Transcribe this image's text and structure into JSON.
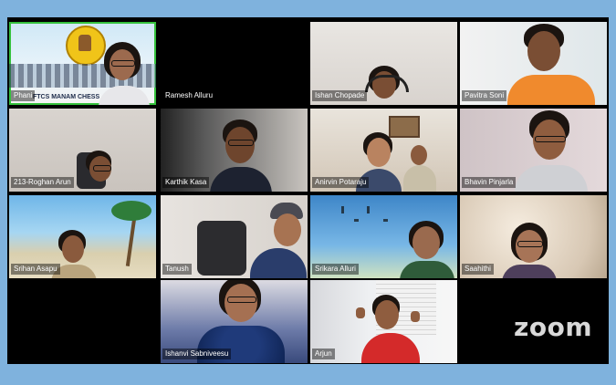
{
  "meeting": {
    "app": "zoom",
    "participants": [
      {
        "name": "Phani",
        "banner": "FTCS MANAM CHESS",
        "active": true
      },
      {
        "name": "Ramesh Alluru"
      },
      {
        "name": "Ishan Chopade"
      },
      {
        "name": "Pavitra Soni"
      },
      {
        "name": "213-Roghan Arun"
      },
      {
        "name": "Karthik Kasa"
      },
      {
        "name": "Anirvin Potaraju"
      },
      {
        "name": "Bhavin Pinjarla"
      },
      {
        "name": "Srihan Asapu"
      },
      {
        "name": "Tanush"
      },
      {
        "name": "Srikara Alluri"
      },
      {
        "name": "Saahithi"
      },
      {
        "name": "Ishanvi Sabniveesu"
      },
      {
        "name": "Arjun"
      }
    ]
  }
}
